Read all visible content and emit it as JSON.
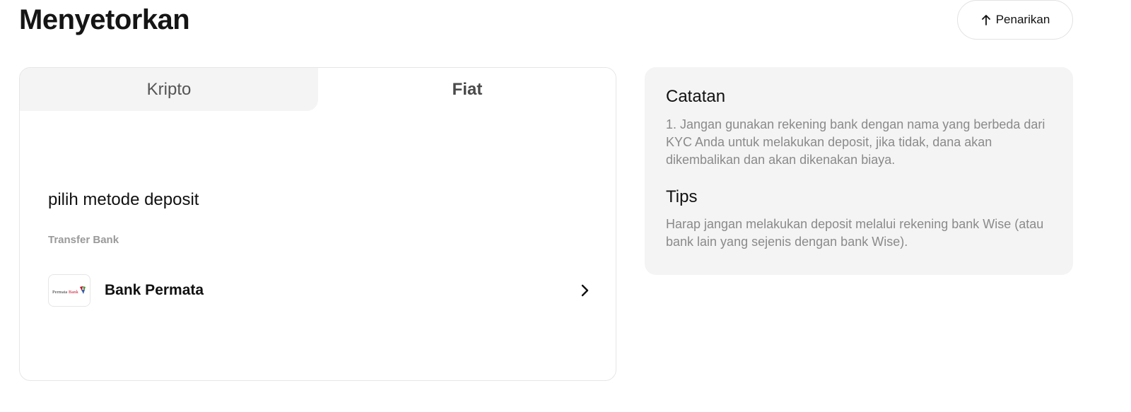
{
  "header": {
    "title": "Menyetorkan",
    "withdraw_label": "Penarikan",
    "withdraw_icon": "arrow-up-icon"
  },
  "deposit": {
    "tabs": [
      {
        "label": "Kripto",
        "active": false
      },
      {
        "label": "Fiat",
        "active": true
      }
    ],
    "method_title": "pilih metode deposit",
    "section_label": "Transfer Bank",
    "banks": [
      {
        "name": "Bank Permata",
        "logo_text": "PermataBank",
        "icon": "chevron-right-icon"
      }
    ]
  },
  "notes": {
    "heading": "Catatan",
    "text": "1. Jangan gunakan rekening bank dengan nama yang berbeda dari KYC Anda untuk melakukan deposit, jika tidak, dana akan dikembalikan dan akan dikenakan biaya.",
    "tips_heading": "Tips",
    "tips_text": "Harap jangan melakukan deposit melalui rekening bank Wise (atau bank lain yang sejenis dengan bank Wise)."
  },
  "colors": {
    "tab_inactive_bg": "#f4f4f4",
    "notes_bg": "#f4f4f4",
    "muted_text": "#8a8a8a",
    "brand_red": "#c8102e",
    "brand_green": "#4a9a3a"
  }
}
